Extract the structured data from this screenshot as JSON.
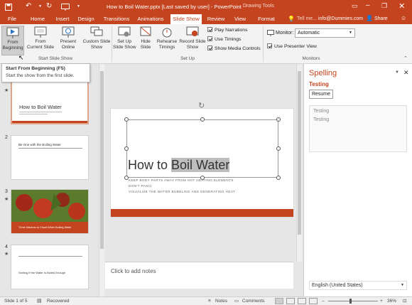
{
  "titlebar": {
    "file_title": "How to Boil Water.pptx [Last saved by user] - PowerPoint",
    "context_title": "Drawing Tools"
  },
  "tabs": [
    "File",
    "Home",
    "Insert",
    "Design",
    "Transitions",
    "Animations",
    "Slide Show",
    "Review",
    "View",
    "Format"
  ],
  "active_tab": "Slide Show",
  "tell_me": "Tell me...",
  "user": "info@Dummies.com",
  "share": "Share",
  "ribbon": {
    "from_beginning": [
      "From",
      "Beginning"
    ],
    "from_current": [
      "From",
      "Current Slide"
    ],
    "present_online": [
      "Present",
      "Online"
    ],
    "custom_show": [
      "Custom Slide",
      "Show"
    ],
    "setup_show": [
      "Set Up",
      "Slide Show"
    ],
    "hide_slide": [
      "Hide",
      "Slide"
    ],
    "rehearse": [
      "Rehearse",
      "Timings"
    ],
    "record": [
      "Record Slide",
      "Show"
    ],
    "play_narrations": "Play Narrations",
    "use_timings": "Use Timings",
    "show_media": "Show Media Controls",
    "monitor_label": "Monitor:",
    "monitor_value": "Automatic",
    "presenter_view": "Use Presenter View",
    "group_start": "Start Slide Show",
    "group_setup": "Set Up",
    "group_monitors": "Monitors"
  },
  "tooltip": {
    "title": "Start From Beginning (F5)",
    "body": "Start the show from the first slide."
  },
  "thumbnails": [
    {
      "num": "",
      "title": "How to Boil Water"
    },
    {
      "num": "2",
      "title": "Be One with the Boiling Water"
    },
    {
      "num": "3",
      "title": "Three Mantras to Chant When Boiling Water"
    },
    {
      "num": "4",
      "title": "Smiling If the Water Is Boiled Enough"
    }
  ],
  "slide": {
    "title_plain": "How to ",
    "title_selected": "Boil Water",
    "bullets": [
      "KEEP BODY PARTS AWAY FROM HOT HEATING ELEMENTS",
      "DON'T PANIC",
      "VISUALIZE THE WATER BUBBLING AND GENERATING HEAT"
    ]
  },
  "notes_placeholder": "Click to add notes",
  "spelling": {
    "header": "Spelling",
    "word": "Testing",
    "resume": "Resume",
    "suggestions": [
      "Testing",
      "Testing"
    ],
    "language": "English (United States)"
  },
  "status": {
    "slide_of": "Slide 1 of 5",
    "recovered": "Recovered",
    "notes": "Notes",
    "comments": "Comments",
    "zoom": "36%"
  },
  "colors": {
    "accent": "#c4441f"
  }
}
